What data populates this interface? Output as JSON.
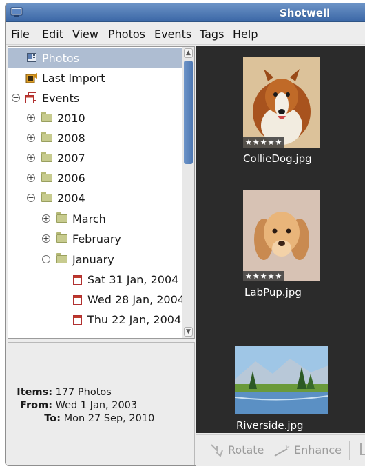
{
  "window": {
    "title": "Shotwell"
  },
  "menu": [
    "File",
    "Edit",
    "View",
    "Photos",
    "Events",
    "Tags",
    "Help"
  ],
  "menu_mnemonics": [
    "F",
    "E",
    "V",
    "P",
    "n",
    "T",
    "H"
  ],
  "sidebar": {
    "photos": "Photos",
    "last_import": "Last Import",
    "events": "Events",
    "years": [
      "2010",
      "2008",
      "2007",
      "2006",
      "2004"
    ],
    "months": [
      "March",
      "February",
      "January"
    ],
    "days": [
      "Sat 31 Jan, 2004",
      "Wed 28 Jan, 2004",
      "Thu 22 Jan, 2004"
    ]
  },
  "info": {
    "items_label": "Items:",
    "items_value": "177 Photos",
    "from_label": "From:",
    "from_value": "Wed 1 Jan, 2003",
    "to_label": "To:",
    "to_value": "Mon 27 Sep, 2010"
  },
  "photos": [
    {
      "name": "CollieDog.jpg",
      "rating": "★★★★★"
    },
    {
      "name": "LabPup.jpg",
      "rating": "★★★★★"
    },
    {
      "name": "Riverside.jpg",
      "rating": ""
    }
  ],
  "toolbar": {
    "rotate": "Rotate",
    "enhance": "Enhance"
  },
  "colors": {
    "titlebar": "#4a76b3",
    "selection": "#aebdd2",
    "viewer_bg": "#2b2b2b"
  }
}
